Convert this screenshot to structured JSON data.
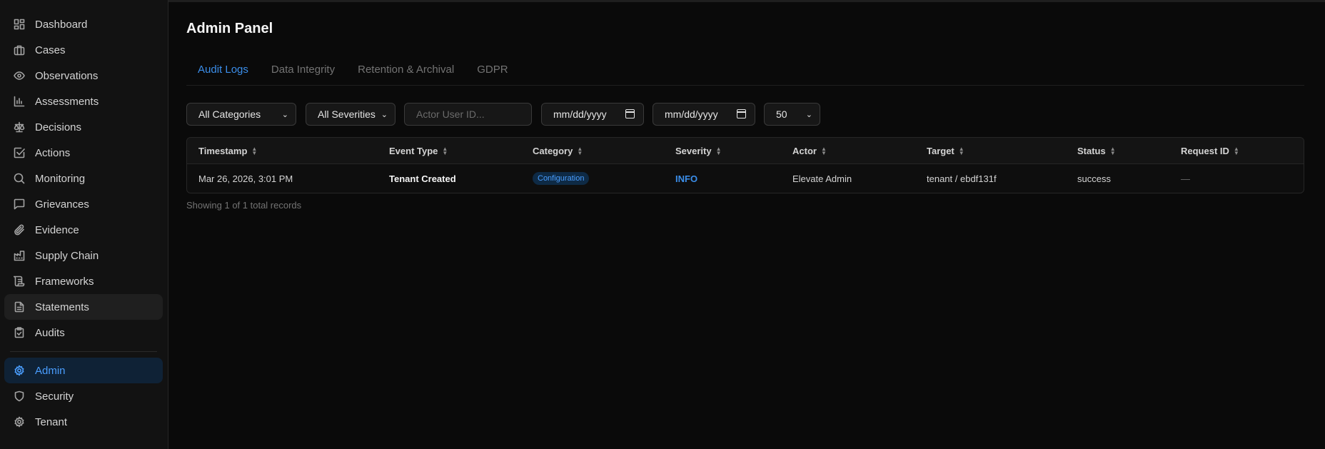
{
  "sidebar": {
    "items": [
      {
        "label": "Dashboard",
        "icon": "grid-icon"
      },
      {
        "label": "Cases",
        "icon": "briefcase-icon"
      },
      {
        "label": "Observations",
        "icon": "eye-icon"
      },
      {
        "label": "Assessments",
        "icon": "bar-chart-icon"
      },
      {
        "label": "Decisions",
        "icon": "scale-icon"
      },
      {
        "label": "Actions",
        "icon": "check-square-icon"
      },
      {
        "label": "Monitoring",
        "icon": "search-icon"
      },
      {
        "label": "Grievances",
        "icon": "message-icon"
      },
      {
        "label": "Evidence",
        "icon": "paperclip-icon"
      },
      {
        "label": "Supply Chain",
        "icon": "factory-icon"
      },
      {
        "label": "Frameworks",
        "icon": "scroll-icon"
      },
      {
        "label": "Statements",
        "icon": "file-text-icon"
      },
      {
        "label": "Audits",
        "icon": "clipboard-check-icon"
      }
    ],
    "admin_items": [
      {
        "label": "Admin",
        "icon": "gear-icon"
      },
      {
        "label": "Security",
        "icon": "shield-icon"
      },
      {
        "label": "Tenant",
        "icon": "gear-icon"
      }
    ]
  },
  "page": {
    "title": "Admin Panel"
  },
  "tabs": [
    "Audit Logs",
    "Data Integrity",
    "Retention & Archival",
    "GDPR"
  ],
  "filters": {
    "category": "All Categories",
    "severity": "All Severities",
    "actor_placeholder": "Actor User ID...",
    "date_from": "mm/dd/yyyy",
    "date_to": "mm/dd/yyyy",
    "page_size": "50"
  },
  "table": {
    "columns": [
      "Timestamp",
      "Event Type",
      "Category",
      "Severity",
      "Actor",
      "Target",
      "Status",
      "Request ID"
    ],
    "rows": [
      {
        "timestamp": "Mar 26, 2026, 3:01 PM",
        "event_type": "Tenant Created",
        "category": "Configuration",
        "severity": "INFO",
        "actor": "Elevate Admin",
        "target": "tenant / ebdf131f",
        "status": "success",
        "request_id": "—"
      }
    ]
  },
  "footer": {
    "records_text": "Showing 1 of 1 total records"
  },
  "colors": {
    "accent": "#3b8eea",
    "background": "#0a0a0a",
    "sidebar": "#121212"
  }
}
